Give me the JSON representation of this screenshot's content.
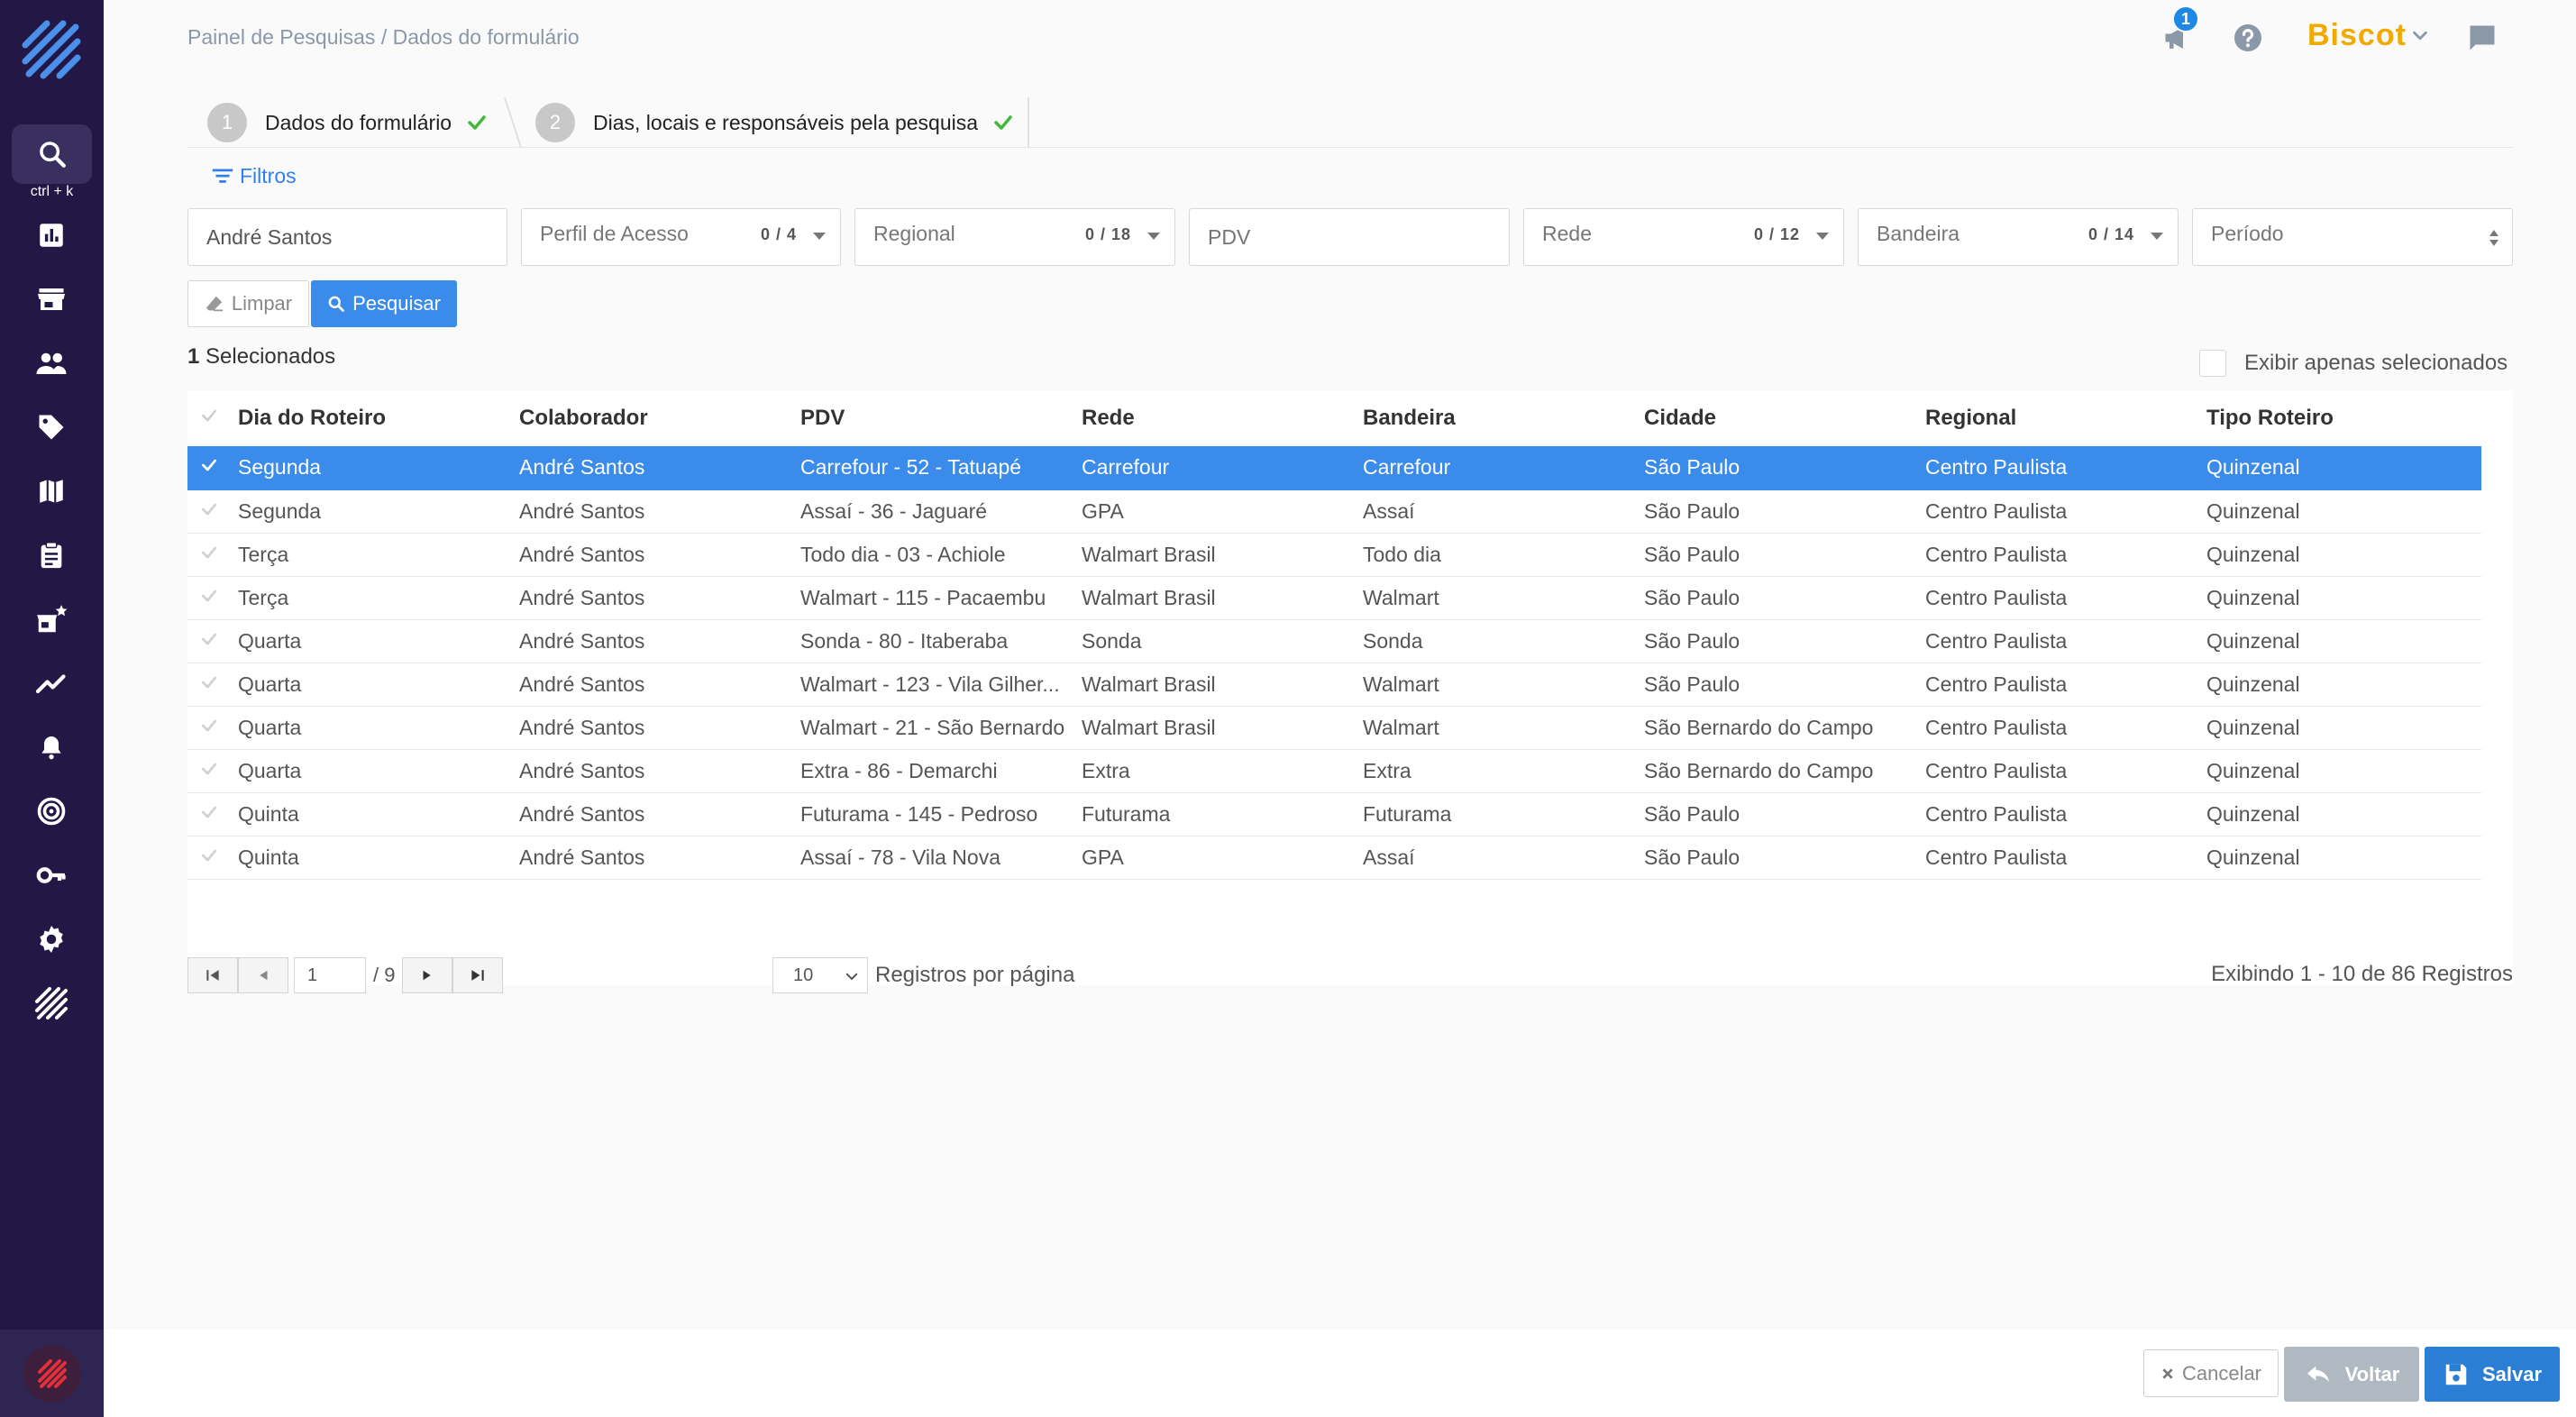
{
  "shortcut_hint": "ctrl + k",
  "breadcrumb": {
    "root": "Painel de Pesquisas",
    "separator": "/",
    "current": "Dados do formulário"
  },
  "header": {
    "notification_count": "1",
    "brand": "Biscot"
  },
  "steps": [
    {
      "number": "1",
      "label": "Dados do formulário"
    },
    {
      "number": "2",
      "label": "Dias, locais e responsáveis pela pesquisa"
    }
  ],
  "filters": {
    "title": "Filtros",
    "collaborator_value": "André Santos",
    "perfil": {
      "label": "Perfil de Acesso",
      "count": "0 / 4"
    },
    "regional": {
      "label": "Regional",
      "count": "0 / 18"
    },
    "pdv_placeholder": "PDV",
    "rede": {
      "label": "Rede",
      "count": "0 / 12"
    },
    "bandeira": {
      "label": "Bandeira",
      "count": "0 / 14"
    },
    "periodo": {
      "label": "Período"
    },
    "clear_label": "Limpar",
    "search_label": "Pesquisar"
  },
  "selection": {
    "count": "1",
    "label": "Selecionados",
    "only_selected_label": "Exibir apenas selecionados"
  },
  "table": {
    "columns": [
      "Dia do Roteiro",
      "Colaborador",
      "PDV",
      "Rede",
      "Bandeira",
      "Cidade",
      "Regional",
      "Tipo Roteiro"
    ],
    "rows": [
      [
        "Segunda",
        "André Santos",
        "Carrefour - 52 - Tatuapé",
        "Carrefour",
        "Carrefour",
        "São Paulo",
        "Centro Paulista",
        "Quinzenal"
      ],
      [
        "Segunda",
        "André Santos",
        "Assaí - 36 - Jaguaré",
        "GPA",
        "Assaí",
        "São Paulo",
        "Centro Paulista",
        "Quinzenal"
      ],
      [
        "Terça",
        "André Santos",
        "Todo dia - 03 - Achiole",
        "Walmart Brasil",
        "Todo dia",
        "São Paulo",
        "Centro Paulista",
        "Quinzenal"
      ],
      [
        "Terça",
        "André Santos",
        "Walmart - 115 - Pacaembu",
        "Walmart Brasil",
        "Walmart",
        "São Paulo",
        "Centro Paulista",
        "Quinzenal"
      ],
      [
        "Quarta",
        "André Santos",
        "Sonda - 80 - Itaberaba",
        "Sonda",
        "Sonda",
        "São Paulo",
        "Centro Paulista",
        "Quinzenal"
      ],
      [
        "Quarta",
        "André Santos",
        "Walmart - 123 - Vila Gilher...",
        "Walmart Brasil",
        "Walmart",
        "São Paulo",
        "Centro Paulista",
        "Quinzenal"
      ],
      [
        "Quarta",
        "André Santos",
        "Walmart - 21 - São Bernardo",
        "Walmart Brasil",
        "Walmart",
        "São Bernardo do Campo",
        "Centro Paulista",
        "Quinzenal"
      ],
      [
        "Quarta",
        "André Santos",
        "Extra - 86 - Demarchi",
        "Extra",
        "Extra",
        "São Bernardo do Campo",
        "Centro Paulista",
        "Quinzenal"
      ],
      [
        "Quinta",
        "André Santos",
        "Futurama - 145 - Pedroso",
        "Futurama",
        "Futurama",
        "São Paulo",
        "Centro Paulista",
        "Quinzenal"
      ],
      [
        "Quinta",
        "André Santos",
        "Assaí - 78 - Vila Nova",
        "GPA",
        "Assaí",
        "São Paulo",
        "Centro Paulista",
        "Quinzenal"
      ]
    ],
    "selected_row_index": 0
  },
  "pagination": {
    "current_page": "1",
    "total_pages": "/ 9",
    "per_page": "10",
    "per_page_label": "Registros por página",
    "records_info": "Exibindo 1 - 10 de 86 Registros"
  },
  "footer": {
    "cancel_label": "Cancelar",
    "back_label": "Voltar",
    "save_label": "Salvar"
  },
  "colors": {
    "sidebar": "#221745",
    "primary": "#3b8bea",
    "brand": "#f2a900",
    "success": "#43b83a"
  }
}
